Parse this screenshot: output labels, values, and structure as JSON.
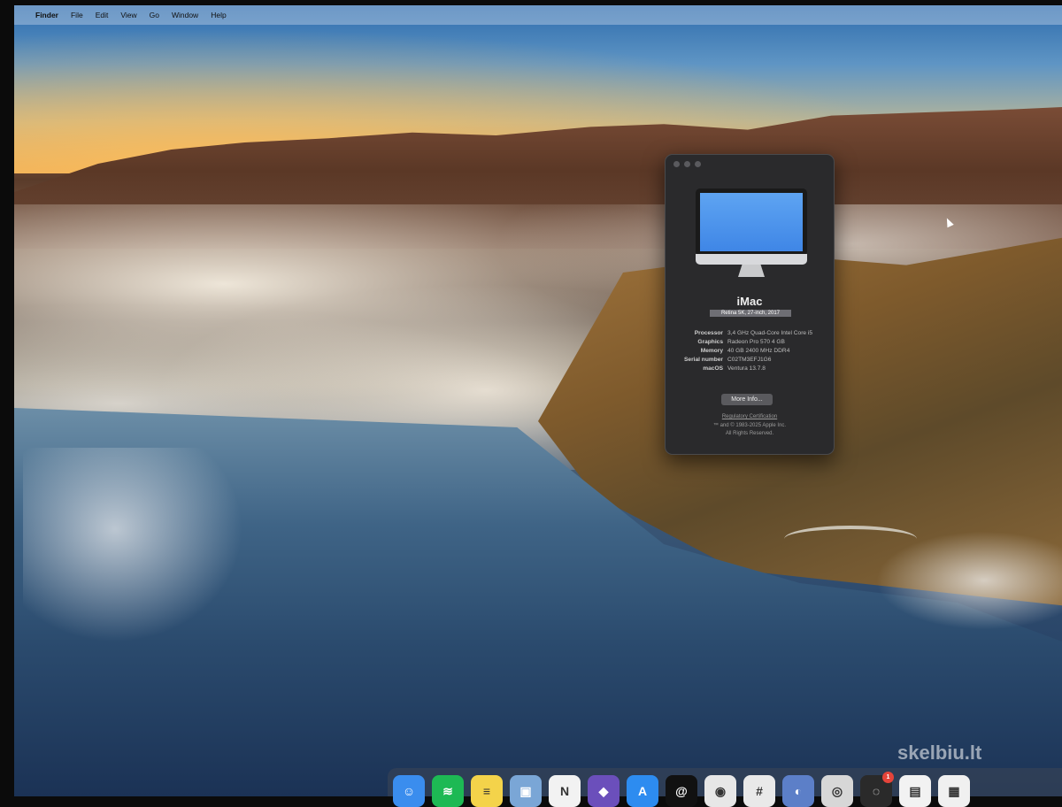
{
  "menubar": {
    "apple": "",
    "app": "Finder",
    "items": [
      "File",
      "Edit",
      "View",
      "Go",
      "Window",
      "Help"
    ]
  },
  "about": {
    "model": "iMac",
    "submodel": "Retina 5K, 27-inch, 2017",
    "specs": [
      {
        "label": "Processor",
        "value": "3,4 GHz Quad-Core Intel Core i5"
      },
      {
        "label": "Graphics",
        "value": "Radeon Pro 570 4 GB"
      },
      {
        "label": "Memory",
        "value": "40 GB 2400 MHz DDR4"
      },
      {
        "label": "Serial number",
        "value": "C02TM3EFJ1G6"
      },
      {
        "label": "macOS",
        "value": "Ventura 13.7.8"
      }
    ],
    "more_info": "More Info...",
    "regulatory": "Regulatory Certification",
    "copyright_line1": "™ and © 1983-2025 Apple Inc.",
    "copyright_line2": "All Rights Reserved."
  },
  "watermark": "skelbiu.lt",
  "dock": {
    "items": [
      {
        "icon": "finder-icon",
        "color": "#3a8dee",
        "glyph": "☺"
      },
      {
        "icon": "spotify-icon",
        "color": "#1db954",
        "glyph": "≋"
      },
      {
        "icon": "notes-icon",
        "color": "#f4d34a",
        "glyph": "≡"
      },
      {
        "icon": "preview-icon",
        "color": "#7aa6d6",
        "glyph": "▣"
      },
      {
        "icon": "notion-icon",
        "color": "#f2f2f2",
        "glyph": "N"
      },
      {
        "icon": "obsidian-icon",
        "color": "#6b4fbb",
        "glyph": "◆"
      },
      {
        "icon": "app-store-icon",
        "color": "#2d8cf0",
        "glyph": "A"
      },
      {
        "icon": "threads-icon",
        "color": "#111111",
        "glyph": "@"
      },
      {
        "icon": "chrome-icon",
        "color": "#e7e7e7",
        "glyph": "◉"
      },
      {
        "icon": "slack-icon",
        "color": "#e9e9e9",
        "glyph": "#"
      },
      {
        "icon": "contacts-icon",
        "color": "#5c7fc8",
        "glyph": "◐"
      },
      {
        "icon": "disk-utility-icon",
        "color": "#d7d7d7",
        "glyph": "◎"
      },
      {
        "icon": "activity-icon",
        "color": "#2a2a2a",
        "glyph": "◌",
        "badge": "1"
      },
      {
        "icon": "document-icon",
        "color": "#f2f2f2",
        "glyph": "▤"
      },
      {
        "icon": "photos-icon",
        "color": "#f0f0f0",
        "glyph": "▦"
      }
    ]
  }
}
